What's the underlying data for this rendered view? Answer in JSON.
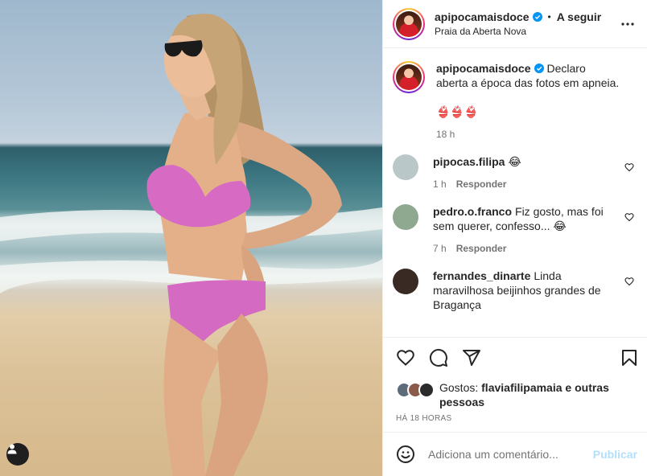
{
  "post": {
    "author": "apipocamaisdoce",
    "follow_label": "A seguir",
    "separator": "•",
    "location": "Praia da Aberta Nova",
    "caption": "Declaro aberta a época das fotos em apneia.",
    "caption_emojis": "👙👙👙",
    "caption_time": "18 h"
  },
  "comments": [
    {
      "user": "pipocas.filipa",
      "text": "😂",
      "time": "1 h",
      "reply": "Responder",
      "avatar_color": "#b9c7c9"
    },
    {
      "user": "pedro.o.franco",
      "text": "Fiz gosto, mas foi sem querer, confesso... 😂",
      "time": "7 h",
      "reply": "Responder",
      "avatar_color": "#8fa890"
    },
    {
      "user": "fernandes_dinarte",
      "text": "Linda maravilhosa beijinhos grandes de Bragança",
      "time": "",
      "reply": "",
      "avatar_color": "#3a2a24"
    }
  ],
  "likes": {
    "prefix": "Gostos:",
    "user": "flaviafilipamaia",
    "suffix": "e outras pessoas",
    "avatar_colors": [
      "#5d6b7a",
      "#8a5a4a",
      "#2b2b2b"
    ]
  },
  "timestamp": "HÁ 18 HORAS",
  "add_comment": {
    "placeholder": "Adiciona um comentário...",
    "publish": "Publicar"
  },
  "colors": {
    "accent_blue": "#0095f6",
    "publish_disabled": "#b2dffc",
    "verified": "#0095f6"
  },
  "icons": {
    "more": "more-horizontal-icon",
    "like": "heart-icon",
    "comment": "comment-bubble-icon",
    "share": "paper-plane-icon",
    "save": "bookmark-icon",
    "emoji": "smiley-icon",
    "tag": "user-tag-icon"
  }
}
